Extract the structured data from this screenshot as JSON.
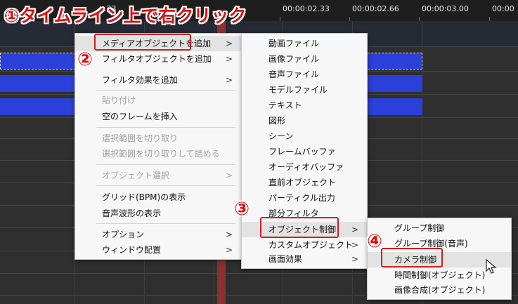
{
  "annotation": {
    "headline": "①タイムライン上で右クリック",
    "markers": [
      "②",
      "③",
      "④"
    ]
  },
  "timeline": {
    "ticks": [
      "00:00:02.33",
      "00:00:02.66",
      "00:00:03.00",
      "00:00"
    ],
    "partial_tick": ".33"
  },
  "context_menu": {
    "items": [
      {
        "label": "メディアオブジェクトを追加",
        "submenu": true,
        "enabled": true
      },
      {
        "label": "フィルタオブジェクトを追加",
        "submenu": true,
        "enabled": true
      },
      {
        "label": "フィルタ効果を追加",
        "submenu": true,
        "enabled": true
      },
      {
        "label": "貼り付け",
        "submenu": false,
        "enabled": false
      },
      {
        "label": "空のフレームを挿入",
        "submenu": false,
        "enabled": true
      },
      {
        "label": "選択範囲を切り取り",
        "submenu": false,
        "enabled": false
      },
      {
        "label": "選択範囲を切り取りして詰める",
        "submenu": false,
        "enabled": false
      },
      {
        "label": "オブジェクト選択",
        "submenu": true,
        "enabled": false
      },
      {
        "label": "グリッド(BPM)の表示",
        "submenu": false,
        "enabled": true
      },
      {
        "label": "音声波形の表示",
        "submenu": false,
        "enabled": true
      },
      {
        "label": "オプション",
        "submenu": true,
        "enabled": true
      },
      {
        "label": "ウィンドウ配置",
        "submenu": true,
        "enabled": true
      }
    ]
  },
  "media_submenu": {
    "items": [
      {
        "label": "動画ファイル",
        "submenu": false
      },
      {
        "label": "画像ファイル",
        "submenu": false
      },
      {
        "label": "音声ファイル",
        "submenu": false
      },
      {
        "label": "モデルファイル",
        "submenu": false
      },
      {
        "label": "テキスト",
        "submenu": false
      },
      {
        "label": "図形",
        "submenu": false
      },
      {
        "label": "シーン",
        "submenu": false
      },
      {
        "label": "フレームバッファ",
        "submenu": false
      },
      {
        "label": "オーディオバッファ",
        "submenu": false
      },
      {
        "label": "直前オブジェクト",
        "submenu": false
      },
      {
        "label": "パーティクル出力",
        "submenu": false
      },
      {
        "label": "部分フィルタ",
        "submenu": false
      },
      {
        "label": "オブジェクト制御",
        "submenu": true
      },
      {
        "label": "カスタムオブジェクト",
        "submenu": true
      },
      {
        "label": "画面効果",
        "submenu": true
      }
    ]
  },
  "control_submenu": {
    "items": [
      {
        "label": "グループ制御"
      },
      {
        "label": "グループ制御(音声)"
      },
      {
        "label": "カメラ制御"
      },
      {
        "label": "時間制御(オブジェクト)"
      },
      {
        "label": "画像合成(オブジェクト)"
      }
    ]
  },
  "icons": {
    "submenu_arrow": ">",
    "cursor": "mouse-pointer-icon"
  },
  "colors": {
    "clip": "#2a40d8",
    "playhead": "#8a3131",
    "annotation": "#e01010"
  }
}
